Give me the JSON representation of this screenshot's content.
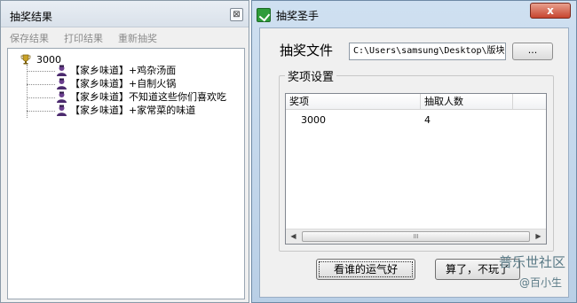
{
  "left_window": {
    "title": "抽奖结果",
    "close_label": "⊠",
    "menu": [
      "保存结果",
      "打印结果",
      "重新抽奖"
    ],
    "tree": {
      "root": "3000",
      "items": [
        "【家乡味道】+鸡杂汤面",
        "【家乡味道】+自制火锅",
        "【家乡味道】不知道这些你们喜欢吃",
        "【家乡味道】+家常菜的味道"
      ]
    }
  },
  "right_window": {
    "title": "抽奖圣手",
    "close_label": "x",
    "file_label": "抽奖文件",
    "file_path": "C:\\Users\\samsung\\Desktop\\版块",
    "browse_label": "...",
    "group_title": "奖项设置",
    "list": {
      "columns": [
        "奖项",
        "抽取人数"
      ],
      "rows": [
        [
          "3000",
          "4"
        ]
      ]
    },
    "scroll_grip": "III",
    "buttons": {
      "lucky": "看谁的运气好",
      "quit": "算了，不玩了"
    }
  },
  "watermark": {
    "line1": "普乐世社区",
    "line2": "@百小生"
  },
  "colors": {
    "title_bar": "#d9e1ea",
    "window_frame": "#b9cfe6",
    "close_red": "#c7452f"
  }
}
